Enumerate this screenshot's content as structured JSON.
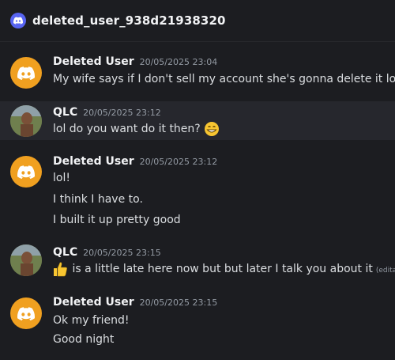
{
  "header": {
    "channel_name": "deleted_user_938d21938320"
  },
  "messages": [
    {
      "username": "Deleted User",
      "timestamp": "20/05/2025 23:04",
      "lines": [
        "My wife says if I don't sell my account she's gonna delete it lol."
      ]
    },
    {
      "username": "QLC",
      "timestamp": "20/05/2025 23:12",
      "lines": [
        "lol do you want do it then?"
      ],
      "emoji": "grinning-face"
    },
    {
      "username": "Deleted User",
      "timestamp": "20/05/2025 23:12",
      "lines": [
        "lol!",
        "I think I have to.",
        "I built it up pretty good"
      ]
    },
    {
      "username": "QLC",
      "timestamp": "20/05/2025 23:15",
      "lines": [
        "is a little late here now but but later I talk you about it"
      ],
      "edited_label": "(editado)",
      "emoji": "thumbs-up"
    },
    {
      "username": "Deleted User",
      "timestamp": "20/05/2025 23:15",
      "lines": [
        "Ok my friend!",
        "Good night"
      ]
    }
  ],
  "colors": {
    "background": "#1c1d21",
    "highlight": "#26272d",
    "discord_blurple": "#5865f2",
    "deleted_avatar": "#f0a020"
  }
}
